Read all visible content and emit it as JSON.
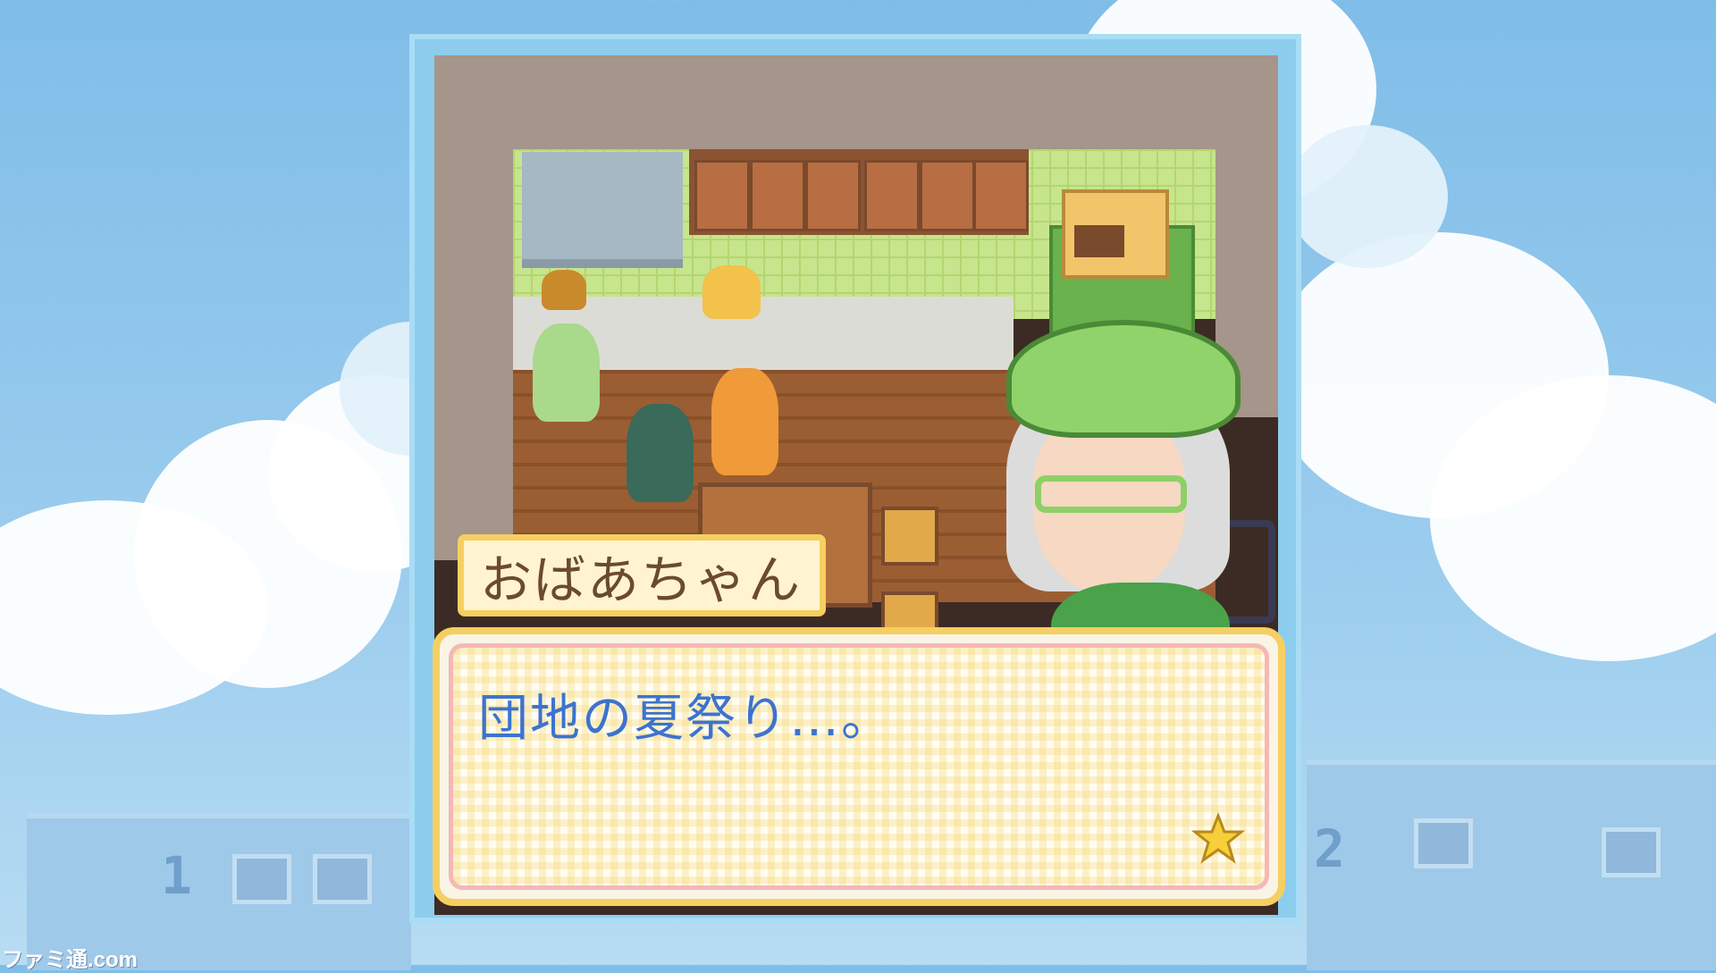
{
  "speaker": {
    "name": "おばあちゃん"
  },
  "dialog": {
    "text": "団地の夏祭り…。"
  },
  "buildings": {
    "left_number": "1",
    "right_number": "2"
  },
  "watermark": "ファミ通.com",
  "icons": {
    "advance": "star-icon"
  },
  "colors": {
    "sky": "#7fbde8",
    "dialog_text": "#3d73cf",
    "dialog_border": "#f6cf62",
    "name_text": "#6b4a30"
  }
}
